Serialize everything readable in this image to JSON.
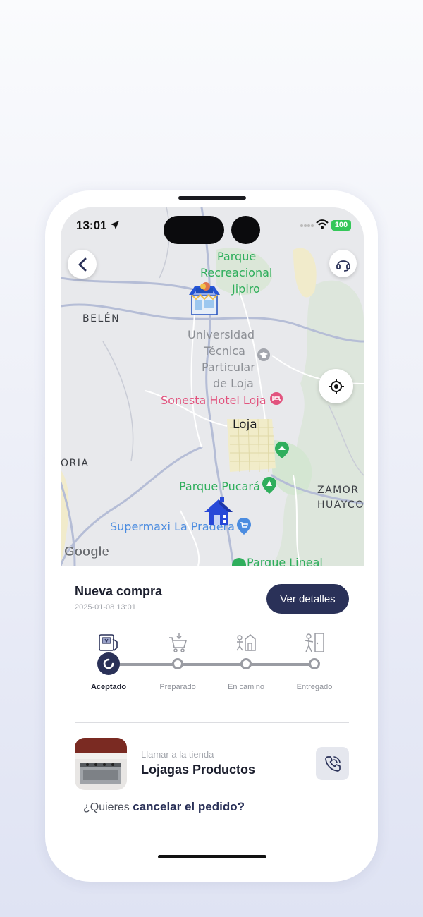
{
  "status_bar": {
    "time": "13:01",
    "battery": "100"
  },
  "map": {
    "labels": {
      "parque_recreacional": [
        "Parque",
        "Recreacional",
        "Jipiro"
      ],
      "belen": "BELÉN",
      "universidad": [
        "Universidad",
        "Técnica",
        "Particular",
        "de Loja"
      ],
      "sonesta": "Sonesta Hotel Loja",
      "loja": "Loja",
      "oria": "ORIA",
      "parque_pucara": "Parque Pucará",
      "zamora": [
        "ZAMOR",
        "HUAYCO"
      ],
      "supermaxi": "Supermaxi La Pradera",
      "parque_lineal": "Parque Lineal"
    },
    "attribution": "Google",
    "markers": [
      "store-marker-icon",
      "home-marker-icon"
    ]
  },
  "header_buttons": {
    "back": "back-chevron-icon",
    "support": "headset-icon",
    "locate": "locate-icon"
  },
  "order": {
    "title": "Nueva compra",
    "date": "2025-01-08 13:01",
    "details_button": "Ver detalles",
    "steps": [
      {
        "label": "Aceptado",
        "icon": "card-payment-icon",
        "active": true
      },
      {
        "label": "Preparado",
        "icon": "cart-icon",
        "active": false
      },
      {
        "label": "En camino",
        "icon": "delivery-icon",
        "active": false
      },
      {
        "label": "Entregado",
        "icon": "door-delivery-icon",
        "active": false
      }
    ]
  },
  "store": {
    "call_caption": "Llamar a la tienda",
    "name": "Lojagas Productos",
    "call_icon": "phone-icon"
  },
  "cancel": {
    "prefix": "¿Quieres",
    "link": "cancelar el pedido?"
  },
  "colors": {
    "primary": "#2a3158",
    "map_green": "#2fae5c",
    "map_pink": "#e2537e",
    "battery": "#34c759"
  }
}
